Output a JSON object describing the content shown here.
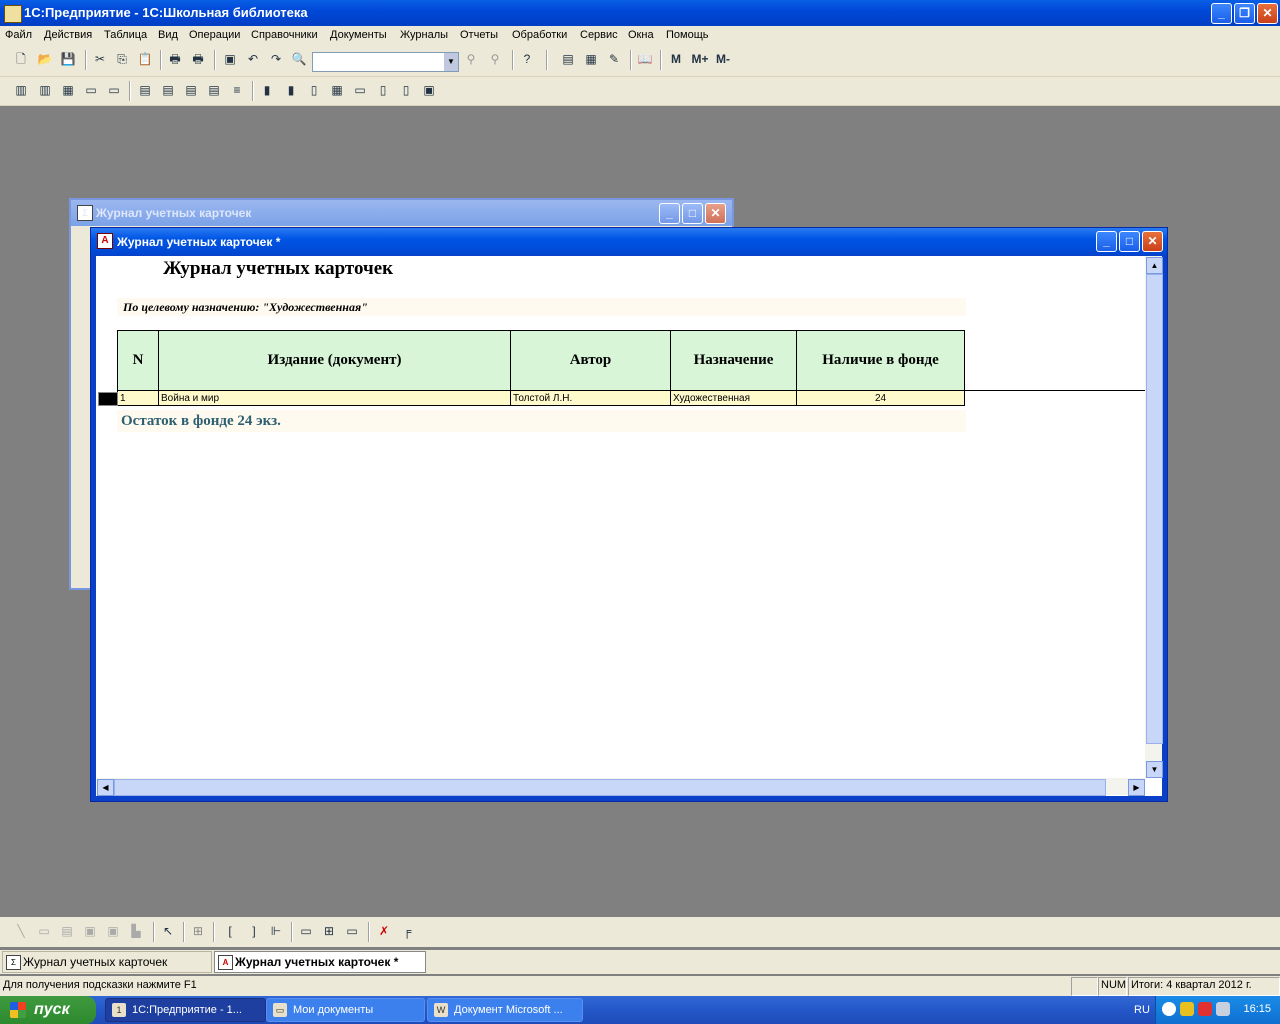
{
  "app": {
    "title": "1С:Предприятие - 1С:Школьная библиотека",
    "minimize": "_",
    "restore": "❐",
    "close": "✕"
  },
  "menu": [
    "Файл",
    "Действия",
    "Таблица",
    "Вид",
    "Операции",
    "Справочники",
    "Документы",
    "Журналы",
    "Отчеты",
    "Обработки",
    "Сервис",
    "Окна",
    "Помощь"
  ],
  "toolbar": {
    "memory_buttons": [
      "M",
      "M+",
      "M-"
    ]
  },
  "back_window": {
    "title": "Журнал учетных карточек"
  },
  "front_window": {
    "title": "Журнал учетных карточек  *",
    "report": {
      "title": "Журнал учетных карточек",
      "filter": "По целевому назначению: \"Художественная\"",
      "columns": [
        "N",
        "Издание (документ)",
        "Автор",
        "Назначение",
        "Наличие в фонде"
      ],
      "rows": [
        {
          "n": "1",
          "title": "Война и мир",
          "author": "Толстой Л.Н.",
          "purpose": "Художественная",
          "stock": "24"
        }
      ],
      "remainder": "Остаток в фонде 24 экз."
    }
  },
  "window_tabs": [
    "Журнал учетных карточек",
    "Журнал учетных карточек  *"
  ],
  "status": {
    "hint": "Для получения подсказки нажмите F1",
    "num": "NUM",
    "totals": "Итоги: 4 квартал 2012 г."
  },
  "taskbar": {
    "start": "пуск",
    "tasks": [
      "1С:Предприятие - 1...",
      "Мои документы",
      "Документ Microsoft ..."
    ],
    "lang": "RU",
    "clock": "16:15"
  }
}
